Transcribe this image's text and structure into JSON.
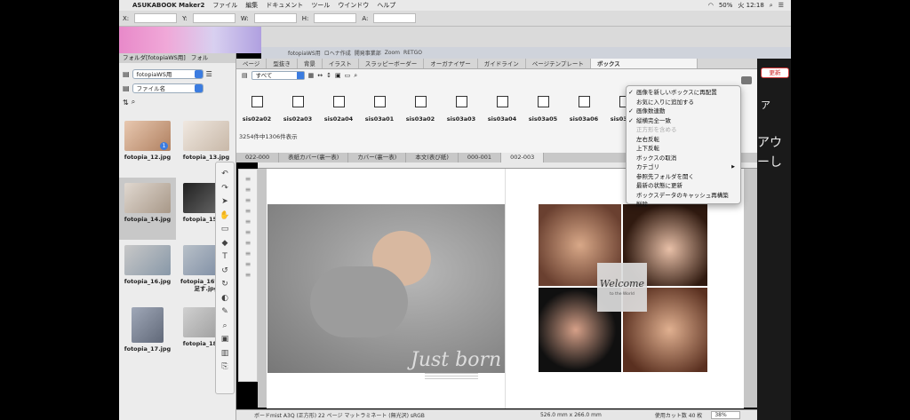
{
  "menubar": {
    "apple": "",
    "app": "ASUKABOOK Maker2",
    "items": [
      "ファイル",
      "編集",
      "ドキュメント",
      "ツール",
      "ウインドウ",
      "ヘルプ"
    ],
    "battery": "50%",
    "clock": "火 12:18"
  },
  "coords": {
    "x": "X:",
    "y": "Y:",
    "w": "W:",
    "h": "H:",
    "a": "A:"
  },
  "bgtabs": [
    "fotopiaWS用",
    "ロヘナ作成",
    "開発事業部",
    "Zoom",
    "RETGO"
  ],
  "folder": {
    "title": "フォルダ[fotopiaWS用]",
    "title2": "フォル",
    "source": "fotopiaWS用",
    "sort": "ファイル名"
  },
  "thumbs": [
    {
      "name": "fotopia_12.jpg",
      "badge": "1"
    },
    {
      "name": "fotopia_13.jpg"
    },
    {
      "name": "fotopia_14.jpg",
      "active": true
    },
    {
      "name": "fotopia_15.jpg"
    },
    {
      "name": "fotopia_16.jpg"
    },
    {
      "name": "fotopia_16背景を足す.jpg"
    },
    {
      "name": "fotopia_17.jpg"
    },
    {
      "name": "fotopia_18.jpg"
    }
  ],
  "main": {
    "tabs": [
      "ページ",
      "型抜き",
      "背景",
      "イラスト",
      "スラッピーボーダー",
      "オーガナイザー",
      "ガイドライン",
      "ページテンプレート",
      "ボックス"
    ],
    "filter": "すべて",
    "boxes": [
      "sis02a02",
      "sis02a03",
      "sis02a04",
      "sis03a01",
      "sis03a02",
      "sis03a03",
      "sis03a04",
      "sis03a05",
      "sis03a06",
      "sis03a07"
    ],
    "count": "3254件中1306件表示",
    "pagetabs": [
      "022-000",
      "表紙カバー(裏一表)",
      "カバー(裏一表)",
      "本文(表び紙)",
      "000-001",
      "002-003"
    ]
  },
  "context": [
    {
      "label": "画像を新しいボックスに再配置",
      "check": true
    },
    {
      "label": "お気に入りに追加する"
    },
    {
      "label": "画像数連動",
      "check": true
    },
    {
      "label": "縦横完全一致",
      "check": true
    },
    {
      "label": "正方形を含める",
      "disabled": true
    },
    {
      "label": "左右反転"
    },
    {
      "label": "上下反転"
    },
    {
      "label": "ボックスの取消"
    },
    {
      "label": "カテゴリ",
      "sub": true
    },
    {
      "label": "参照先フォルダを開く"
    },
    {
      "label": "最新の状態に更新"
    },
    {
      "label": "ボックスデータのキャッシュ再構築"
    },
    {
      "label": "削除"
    }
  ],
  "spread": {
    "title": "Just born",
    "welcome": "Welcome",
    "welcome_sub": "to the World"
  },
  "status": {
    "info": "ボードmist A3Q (正方形) 22 ページ マットラミネート (無光沢) sRGB",
    "size": "526.0 mm x 266.0 mm",
    "cut": "使用カット数 40 枚",
    "zoom": "38%"
  },
  "right": {
    "update": "更新",
    "jp1": "ア",
    "jp2": "アウ",
    "jp3": "ーし"
  }
}
